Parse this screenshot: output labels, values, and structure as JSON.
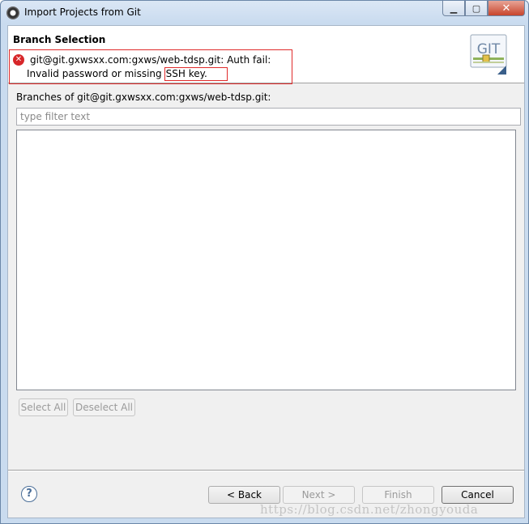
{
  "window": {
    "title": "Import Projects from Git",
    "controls": {
      "minimize": "▁",
      "maximize": "▢",
      "close": "✕"
    }
  },
  "header": {
    "title": "Branch Selection",
    "error_line1": "git@git.gxwsxx.com:gxws/web-tdsp.git: Auth fail:",
    "error_line2_prefix": "Invalid password or missing",
    "error_line2_highlight": "SSH key.",
    "logo_text": "GIT"
  },
  "branches": {
    "label": "Branches of git@git.gxwsxx.com:gxws/web-tdsp.git:",
    "filter_placeholder": "type filter text",
    "filter_value": "",
    "items": []
  },
  "buttons": {
    "select_all": "Select All",
    "deselect_all": "Deselect All",
    "back": "< Back",
    "next": "Next >",
    "finish": "Finish",
    "cancel": "Cancel",
    "help": "?"
  },
  "watermark": "https://blog.csdn.net/zhongyouda",
  "colors": {
    "error_red": "#e02b2b",
    "title_gradient_top": "#dbe7f5",
    "close_button": "#c8452c"
  }
}
